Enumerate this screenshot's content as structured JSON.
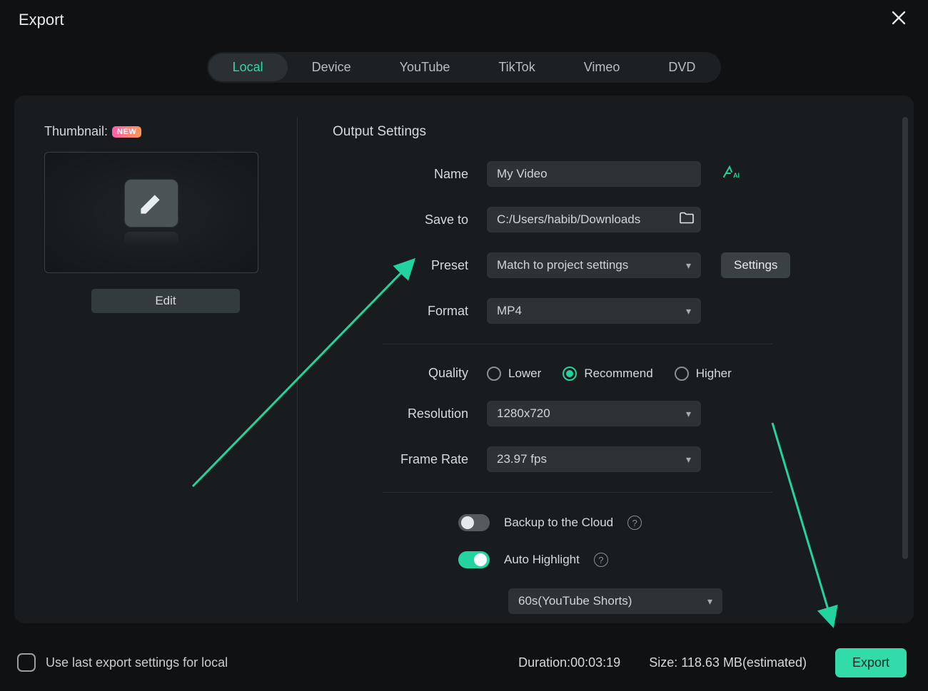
{
  "window": {
    "title": "Export"
  },
  "tabs": [
    "Local",
    "Device",
    "YouTube",
    "TikTok",
    "Vimeo",
    "DVD"
  ],
  "activeTab": 0,
  "thumbnail": {
    "label": "Thumbnail:",
    "badge": "NEW",
    "edit": "Edit"
  },
  "settings": {
    "heading": "Output Settings",
    "name": {
      "label": "Name",
      "value": "My Video"
    },
    "saveto": {
      "label": "Save to",
      "value": "C:/Users/habib/Downloads"
    },
    "preset": {
      "label": "Preset",
      "value": "Match to project settings",
      "settingsBtn": "Settings"
    },
    "format": {
      "label": "Format",
      "value": "MP4"
    },
    "quality": {
      "label": "Quality",
      "options": [
        "Lower",
        "Recommend",
        "Higher"
      ],
      "selected": 1
    },
    "resolution": {
      "label": "Resolution",
      "value": "1280x720"
    },
    "framerate": {
      "label": "Frame Rate",
      "value": "23.97 fps"
    },
    "backup": {
      "label": "Backup to the Cloud",
      "enabled": false
    },
    "autohl": {
      "label": "Auto Highlight",
      "enabled": true,
      "preset": "60s(YouTube Shorts)"
    }
  },
  "footer": {
    "checkbox": "Use last export settings for local",
    "duration": "Duration:00:03:19",
    "size": "Size: 118.63 MB(estimated)",
    "export": "Export"
  }
}
